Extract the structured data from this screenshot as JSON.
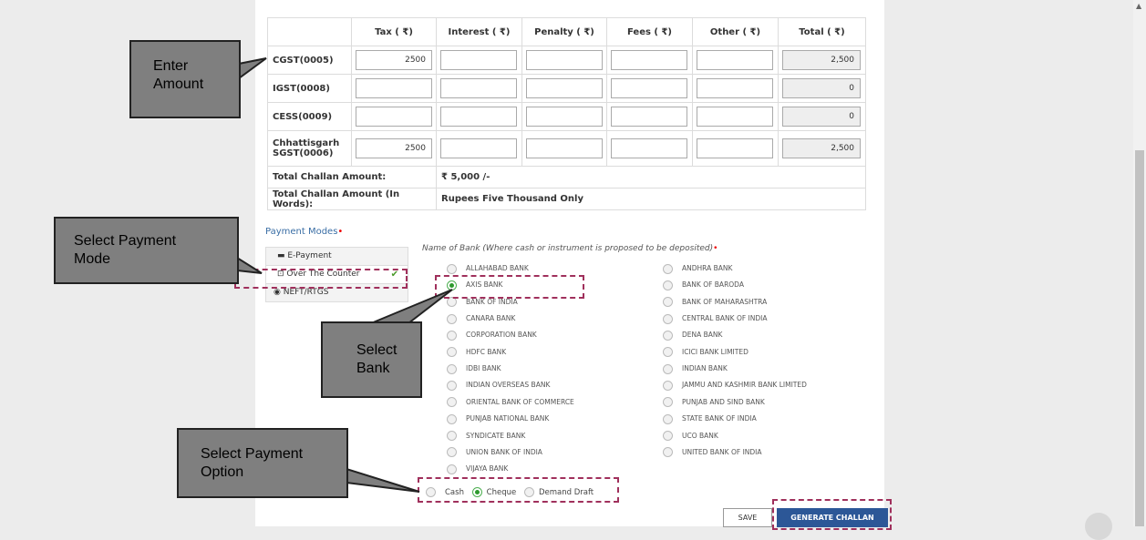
{
  "table": {
    "headers": [
      "",
      "Tax ( ₹)",
      "Interest ( ₹)",
      "Penalty ( ₹)",
      "Fees ( ₹)",
      "Other ( ₹)",
      "Total ( ₹)"
    ],
    "rows": [
      {
        "label": "CGST(0005)",
        "tax": "2500",
        "total": "2,500"
      },
      {
        "label": "IGST(0008)",
        "tax": "",
        "total": "0"
      },
      {
        "label": "CESS(0009)",
        "tax": "",
        "total": "0"
      },
      {
        "label_line1": "Chhattisgarh",
        "label_line2": "SGST(0006)",
        "tax": "2500",
        "total": "2,500"
      }
    ],
    "total_amount_label": "Total Challan Amount:",
    "total_amount_value": "₹ 5,000 /-",
    "total_words_label": "Total Challan Amount (In Words):",
    "total_words_value": "Rupees Five Thousand Only"
  },
  "payment": {
    "title": "Payment Modes",
    "modes": [
      "E-Payment",
      "Over The Counter",
      "NEFT/RTGS"
    ],
    "selected_mode": "Over The Counter",
    "bank_title": "Name of Bank (Where cash or instrument is proposed to be deposited)",
    "banks_left": [
      "ALLAHABAD BANK",
      "AXIS BANK",
      "BANK OF INDIA",
      "CANARA BANK",
      "CORPORATION BANK",
      "HDFC BANK",
      "IDBI BANK",
      "INDIAN OVERSEAS BANK",
      "ORIENTAL BANK OF COMMERCE",
      "PUNJAB NATIONAL BANK",
      "SYNDICATE BANK",
      "UNION BANK OF INDIA",
      "VIJAYA BANK"
    ],
    "banks_right": [
      "ANDHRA BANK",
      "BANK OF BARODA",
      "BANK OF MAHARASHTRA",
      "CENTRAL BANK OF INDIA",
      "DENA BANK",
      "ICICI BANK LIMITED",
      "INDIAN BANK",
      "JAMMU AND KASHMIR BANK LIMITED",
      "PUNJAB AND SIND BANK",
      "STATE BANK OF INDIA",
      "UCO BANK",
      "UNITED BANK OF INDIA"
    ],
    "selected_bank": "AXIS BANK",
    "options": [
      "Cash",
      "Cheque",
      "Demand Draft"
    ],
    "selected_option": "Cheque"
  },
  "buttons": {
    "save": "SAVE",
    "generate": "GENERATE CHALLAN"
  },
  "callouts": {
    "enter_amount_1": "Enter",
    "enter_amount_2": "Amount",
    "payment_mode_1": "Select Payment",
    "payment_mode_2": "Mode",
    "bank_1": "Select",
    "bank_2": "Bank",
    "payment_option_1": "Select Payment",
    "payment_option_2": "Option"
  },
  "colors": {
    "accent": "#2c5797",
    "highlight_dash": "#a0305c",
    "callout_bg": "#7f7f7f"
  }
}
